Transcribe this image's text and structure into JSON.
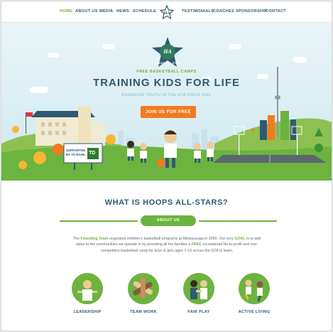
{
  "nav": {
    "left_items": [
      "HOME",
      "ABOUT US",
      "MEDIA",
      "NEWS",
      "SCHEDULE"
    ],
    "right_items": [
      "TESTIMONIALS",
      "COACHES",
      "SPONSORSHIP",
      "CONTACT"
    ],
    "active": "HOME"
  },
  "hero": {
    "badge_text": "HOOPS ALL-STARS",
    "kicker": "FREE BASKETBALL CAMPS",
    "headline": "TRAINING KIDS FOR LIFE",
    "subline": "ENGAGING YOUTH IN THE GTA SINCE 2001",
    "cta_label": "JOIN US FOR FREE",
    "sponsor_sign": {
      "line1": "SUPPORTED",
      "line2": "BY TD BANK",
      "logo": "TD"
    }
  },
  "about": {
    "title": "WHAT IS HOOPS ALL-STARS?",
    "button_label": "ABOUT US",
    "text_parts": [
      {
        "t": "The ",
        "b": false
      },
      {
        "t": "Founding Team",
        "b": true
      },
      {
        "t": " organized children's basketball programs at Mississauga in 2000.  Our very ",
        "b": false
      },
      {
        "t": "GOAL",
        "b": true
      },
      {
        "t": " is to add value to the communities we operate in by providing all the families a ",
        "b": false
      },
      {
        "t": "FREE",
        "b": true
      },
      {
        "t": " recreational No-to-profit and non-competitive basketball camp for boys & girls ages 7-13 across the GTA to learn.",
        "b": false
      }
    ]
  },
  "features": [
    {
      "label": "LEADERSHIP",
      "icon": "leader-kid-icon"
    },
    {
      "label": "TEAM WORK",
      "icon": "team-hands-icon"
    },
    {
      "label": "FAIR PLAY",
      "icon": "fair-play-icon"
    },
    {
      "label": "ACTIVE LIVING",
      "icon": "active-living-icon"
    }
  ],
  "colors": {
    "green": "#6cb33f",
    "navy": "#2f5a72",
    "orange": "#f47a20",
    "sky": "#d9eef3"
  }
}
